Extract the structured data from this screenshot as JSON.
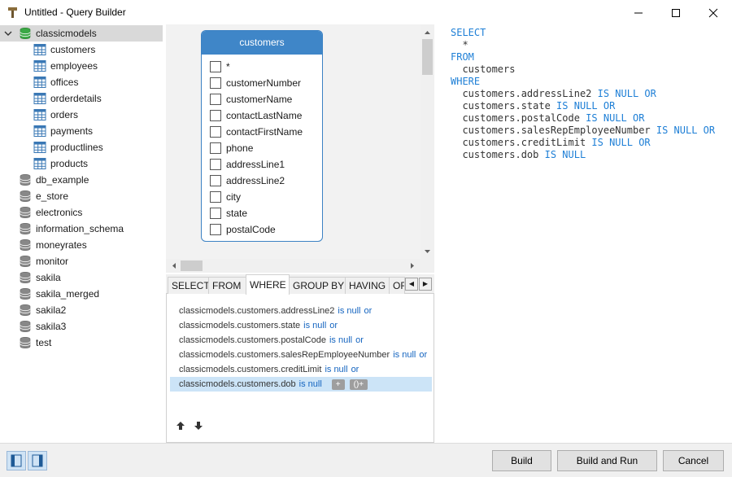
{
  "window": {
    "title": "Untitled - Query Builder",
    "icon": "hammer-icon"
  },
  "tree": {
    "items": [
      {
        "label": "classicmodels",
        "expanded": true,
        "selected": true
      },
      {
        "label": "customers"
      },
      {
        "label": "employees"
      },
      {
        "label": "offices"
      },
      {
        "label": "orderdetails"
      },
      {
        "label": "orders"
      },
      {
        "label": "payments"
      },
      {
        "label": "productlines"
      },
      {
        "label": "products"
      },
      {
        "label": "db_example"
      },
      {
        "label": "e_store"
      },
      {
        "label": "electronics"
      },
      {
        "label": "information_schema"
      },
      {
        "label": "moneyrates"
      },
      {
        "label": "monitor"
      },
      {
        "label": "sakila"
      },
      {
        "label": "sakila_merged"
      },
      {
        "label": "sakila2"
      },
      {
        "label": "sakila3"
      },
      {
        "label": "test"
      }
    ]
  },
  "diagram": {
    "table_title": "customers",
    "fields": [
      "*",
      "customerNumber",
      "customerName",
      "contactLastName",
      "contactFirstName",
      "phone",
      "addressLine1",
      "addressLine2",
      "city",
      "state",
      "postalCode"
    ]
  },
  "tabs": [
    {
      "label": "SELECT"
    },
    {
      "label": "FROM"
    },
    {
      "label": "WHERE",
      "active": true
    },
    {
      "label": "GROUP BY"
    },
    {
      "label": "HAVING"
    },
    {
      "label": "ORDER BY"
    }
  ],
  "where": {
    "conditions": [
      {
        "expr": "classicmodels.customers.addressLine2",
        "op": "is null",
        "conj": "or"
      },
      {
        "expr": "classicmodels.customers.state",
        "op": "is null",
        "conj": "or"
      },
      {
        "expr": "classicmodels.customers.postalCode",
        "op": "is null",
        "conj": "or"
      },
      {
        "expr": "classicmodels.customers.salesRepEmployeeNumber",
        "op": "is null",
        "conj": "or"
      },
      {
        "expr": "classicmodels.customers.creditLimit",
        "op": "is null",
        "conj": "or"
      },
      {
        "expr": "classicmodels.customers.dob",
        "op": "is null",
        "conj": ""
      }
    ],
    "add_label": "+",
    "add_group_label": "()+"
  },
  "sql": {
    "lines": [
      {
        "kw": "SELECT",
        "text": ""
      },
      {
        "indent": "  ",
        "text": "*"
      },
      {
        "kw": "FROM",
        "text": ""
      },
      {
        "indent": "  ",
        "text": "customers"
      },
      {
        "kw": "WHERE",
        "text": ""
      },
      {
        "indent": "  ",
        "text": "customers.addressLine2 ",
        "tail": "IS NULL OR"
      },
      {
        "indent": "  ",
        "text": "customers.state ",
        "tail": "IS NULL OR"
      },
      {
        "indent": "  ",
        "text": "customers.postalCode ",
        "tail": "IS NULL OR"
      },
      {
        "indent": "  ",
        "text": "customers.salesRepEmployeeNumber ",
        "tail": "IS NULL OR"
      },
      {
        "indent": "  ",
        "text": "customers.creditLimit ",
        "tail": "IS NULL OR"
      },
      {
        "indent": "  ",
        "text": "customers.dob ",
        "tail": "IS NULL"
      }
    ]
  },
  "footer": {
    "build_label": "Build",
    "build_run_label": "Build and Run",
    "cancel_label": "Cancel"
  },
  "colors": {
    "accent": "#3f86c8",
    "keyword": "#1e7fd6",
    "selection": "#cce4f7"
  }
}
